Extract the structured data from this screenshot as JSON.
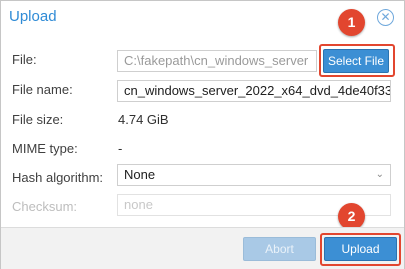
{
  "dialog": {
    "title": "Upload",
    "close_icon": "close-circle-icon"
  },
  "form": {
    "file": {
      "label": "File:",
      "value": "C:\\fakepath\\cn_windows_server",
      "button_label": "Select File"
    },
    "file_name": {
      "label": "File name:",
      "value": "cn_windows_server_2022_x64_dvd_4de40f33"
    },
    "file_size": {
      "label": "File size:",
      "value": "4.74 GiB"
    },
    "mime_type": {
      "label": "MIME type:",
      "value": "-"
    },
    "hash_algorithm": {
      "label": "Hash algorithm:",
      "value": "None",
      "icon": "chevron-down-icon"
    },
    "checksum": {
      "label": "Checksum:",
      "placeholder": "none"
    }
  },
  "footer": {
    "abort_label": "Abort",
    "upload_label": "Upload"
  },
  "annotations": {
    "badge_1": "1",
    "badge_2": "2",
    "color": "#e2462f"
  },
  "colors": {
    "accent": "#3c8fd4",
    "title": "#2f8bd6"
  }
}
